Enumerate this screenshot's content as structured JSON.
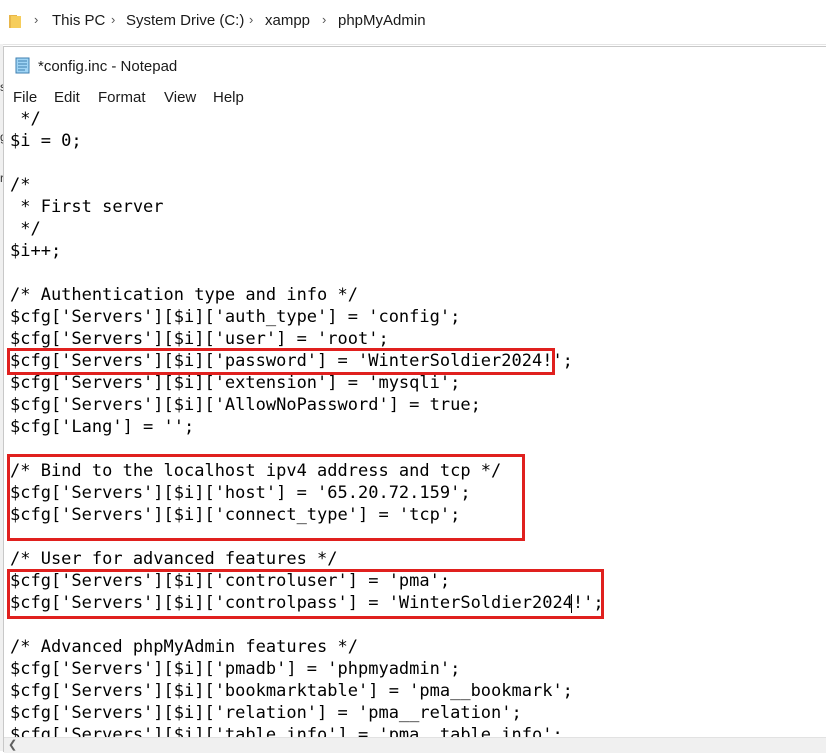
{
  "explorer": {
    "breadcrumb": [
      "This PC",
      "System Drive (C:)",
      "xampp",
      "phpMyAdmin"
    ],
    "separator": "›"
  },
  "notepad": {
    "title": "*config.inc - Notepad",
    "menu": [
      "File",
      "Edit",
      "Format",
      "View",
      "Help"
    ],
    "lines": [
      " */",
      "$i = 0;",
      "",
      "/*",
      " * First server",
      " */",
      "$i++;",
      "",
      "/* Authentication type and info */",
      "$cfg['Servers'][$i]['auth_type'] = 'config';",
      "$cfg['Servers'][$i]['user'] = 'root';",
      "$cfg['Servers'][$i]['password'] = 'WinterSoldier2024!';",
      "$cfg['Servers'][$i]['extension'] = 'mysqli';",
      "$cfg['Servers'][$i]['AllowNoPassword'] = true;",
      "$cfg['Lang'] = '';",
      "",
      "/* Bind to the localhost ipv4 address and tcp */",
      "$cfg['Servers'][$i]['host'] = '65.20.72.159';",
      "$cfg['Servers'][$i]['connect_type'] = 'tcp';",
      "",
      "/* User for advanced features */",
      "$cfg['Servers'][$i]['controluser'] = 'pma';",
      "$cfg['Servers'][$i]['controlpass'] = 'WinterSoldier2024!';",
      "",
      "/* Advanced phpMyAdmin features */",
      "$cfg['Servers'][$i]['pmadb'] = 'phpmyadmin';",
      "$cfg['Servers'][$i]['bookmarktable'] = 'pma__bookmark';",
      "$cfg['Servers'][$i]['relation'] = 'pma__relation';",
      "$cfg['Servers'][$i]['table_info'] = 'pma__table_info';"
    ]
  },
  "highlight_color": "#e0201e",
  "left_glyphs": [
    "s",
    "g",
    "r"
  ]
}
